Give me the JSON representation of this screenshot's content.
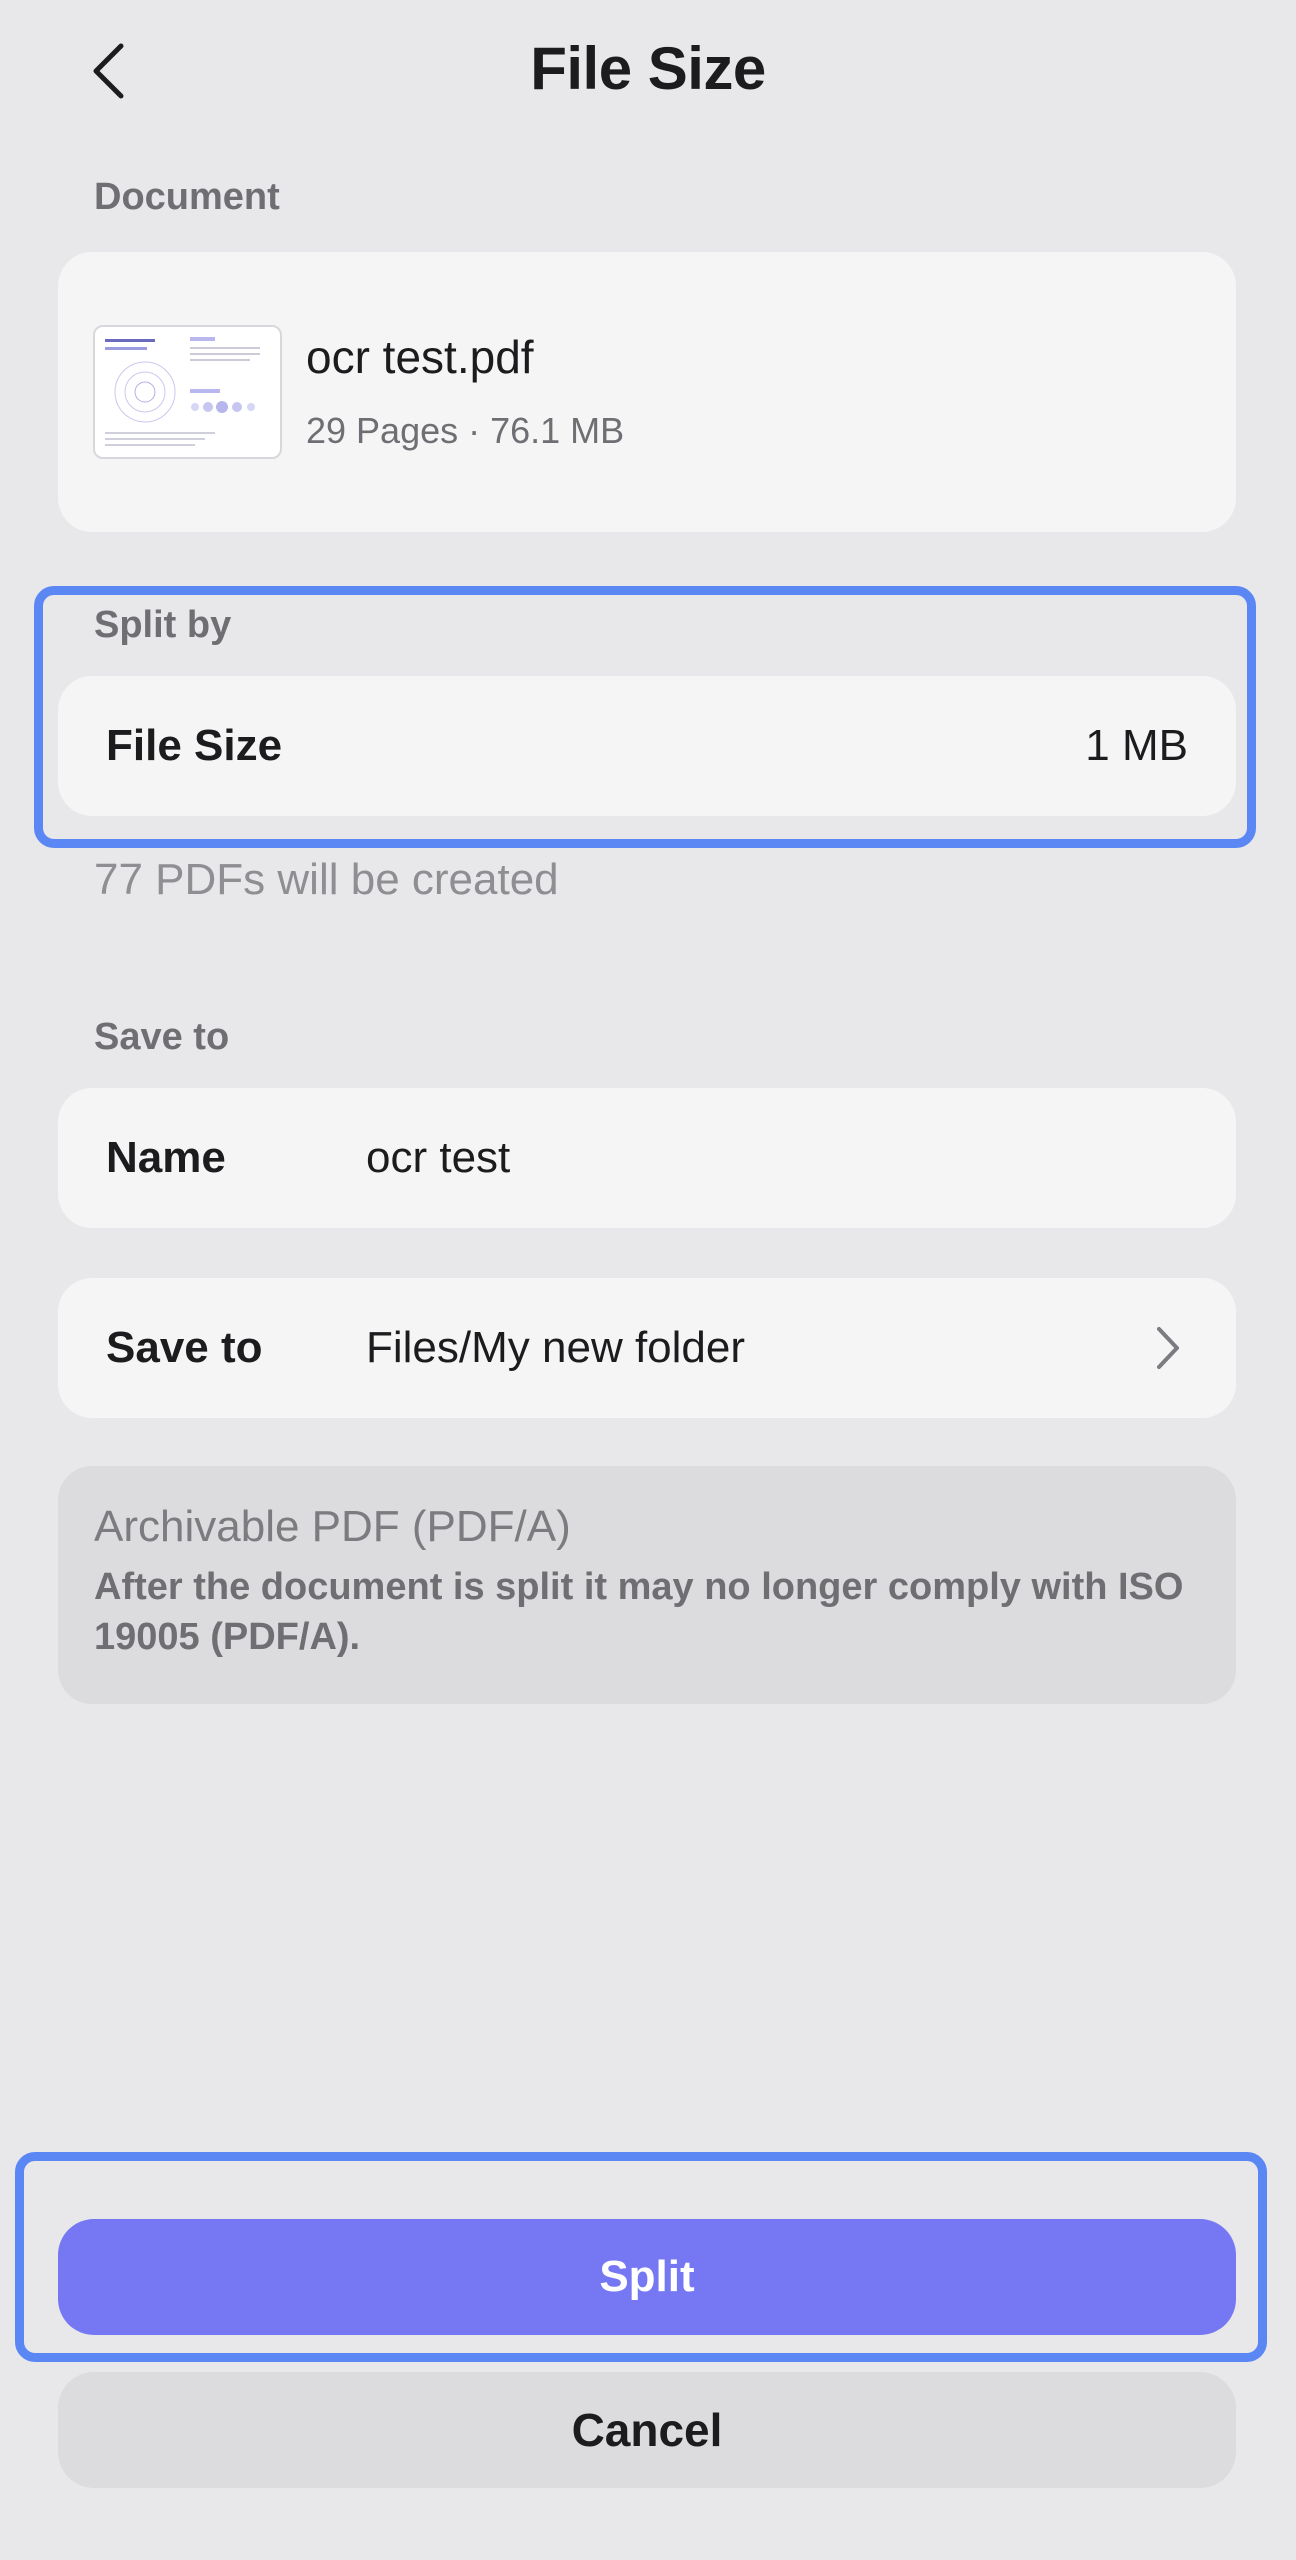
{
  "header": {
    "title": "File Size"
  },
  "document": {
    "section_label": "Document",
    "file_name": "ocr test.pdf",
    "meta": "29 Pages · 76.1 MB"
  },
  "split": {
    "section_label": "Split by",
    "option_label": "File Size",
    "option_value": "1 MB",
    "info": "77 PDFs will be created"
  },
  "save": {
    "section_label": "Save to",
    "name_label": "Name",
    "name_value": "ocr test",
    "location_label": "Save to",
    "location_value": "Files/My new folder"
  },
  "archive": {
    "title": "Archivable PDF (PDF/A)",
    "description": "After the document is split it may no longer comply with ISO 19005 (PDF/A)."
  },
  "actions": {
    "split_label": "Split",
    "cancel_label": "Cancel"
  },
  "icons": {
    "back": "chevron-left-icon",
    "disclosure": "chevron-right-icon"
  },
  "colors": {
    "accent": "#7578f2",
    "highlight": "#5b87f4",
    "background": "#e8e8ea"
  }
}
